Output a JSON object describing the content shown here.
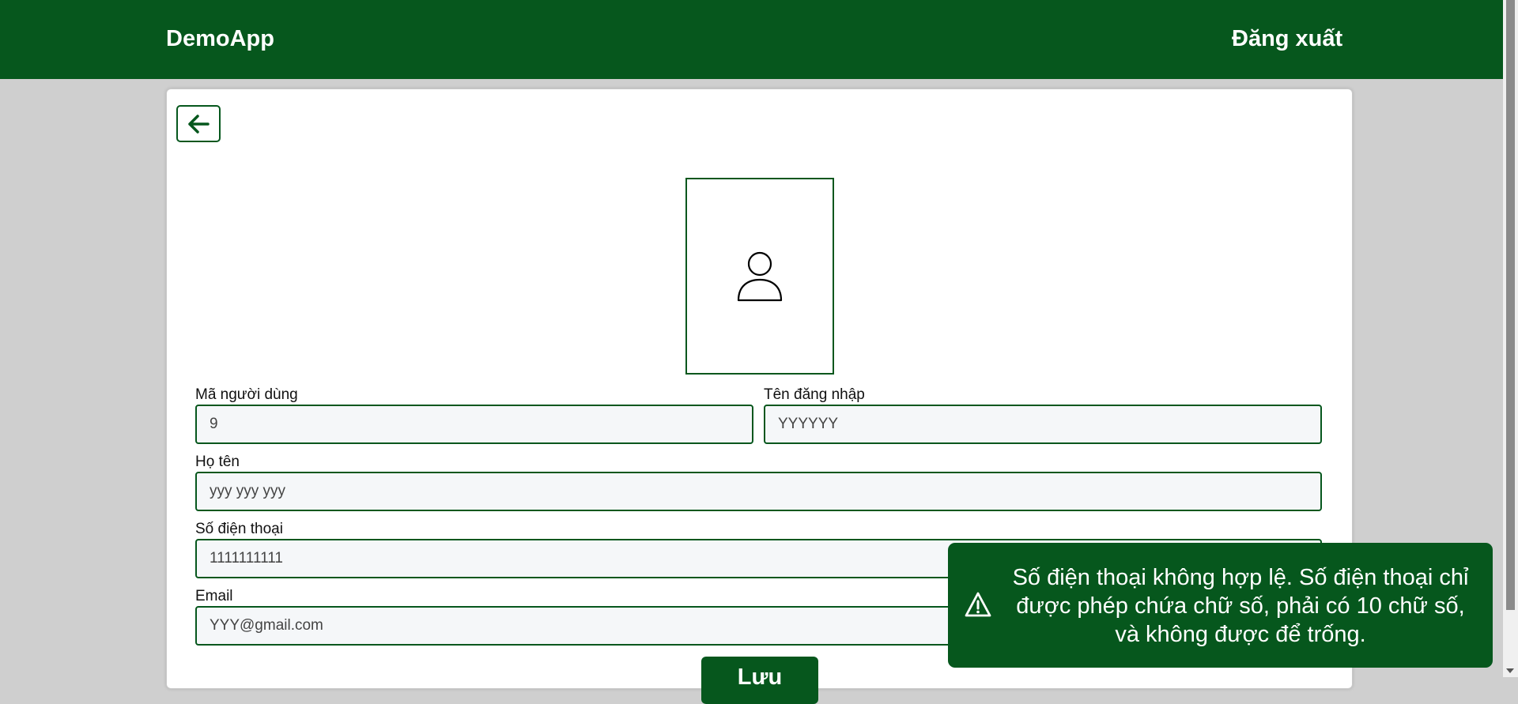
{
  "navbar": {
    "brand": "DemoApp",
    "logout_label": "Đăng xuất"
  },
  "form": {
    "user_id": {
      "label": "Mã người dùng",
      "value": "9"
    },
    "username": {
      "label": "Tên đăng nhập",
      "value": "YYYYYY"
    },
    "full_name": {
      "label": "Họ tên",
      "value": "yyy yyy yyy"
    },
    "phone": {
      "label": "Số điện thoại",
      "value": "1111111111"
    },
    "email": {
      "label": "Email",
      "value": "YYY@gmail.com"
    },
    "save_label": "Lưu"
  },
  "toast": {
    "message": "Số điện thoại không hợp lệ. Số điện thoại chỉ được phép chứa chữ số, phải có 10 chữ số, và không được để trống.",
    "icon": "warning-icon"
  },
  "colors": {
    "primary": "#06571d",
    "background": "#cfcfcf",
    "input_bg": "#f5f7f9"
  }
}
